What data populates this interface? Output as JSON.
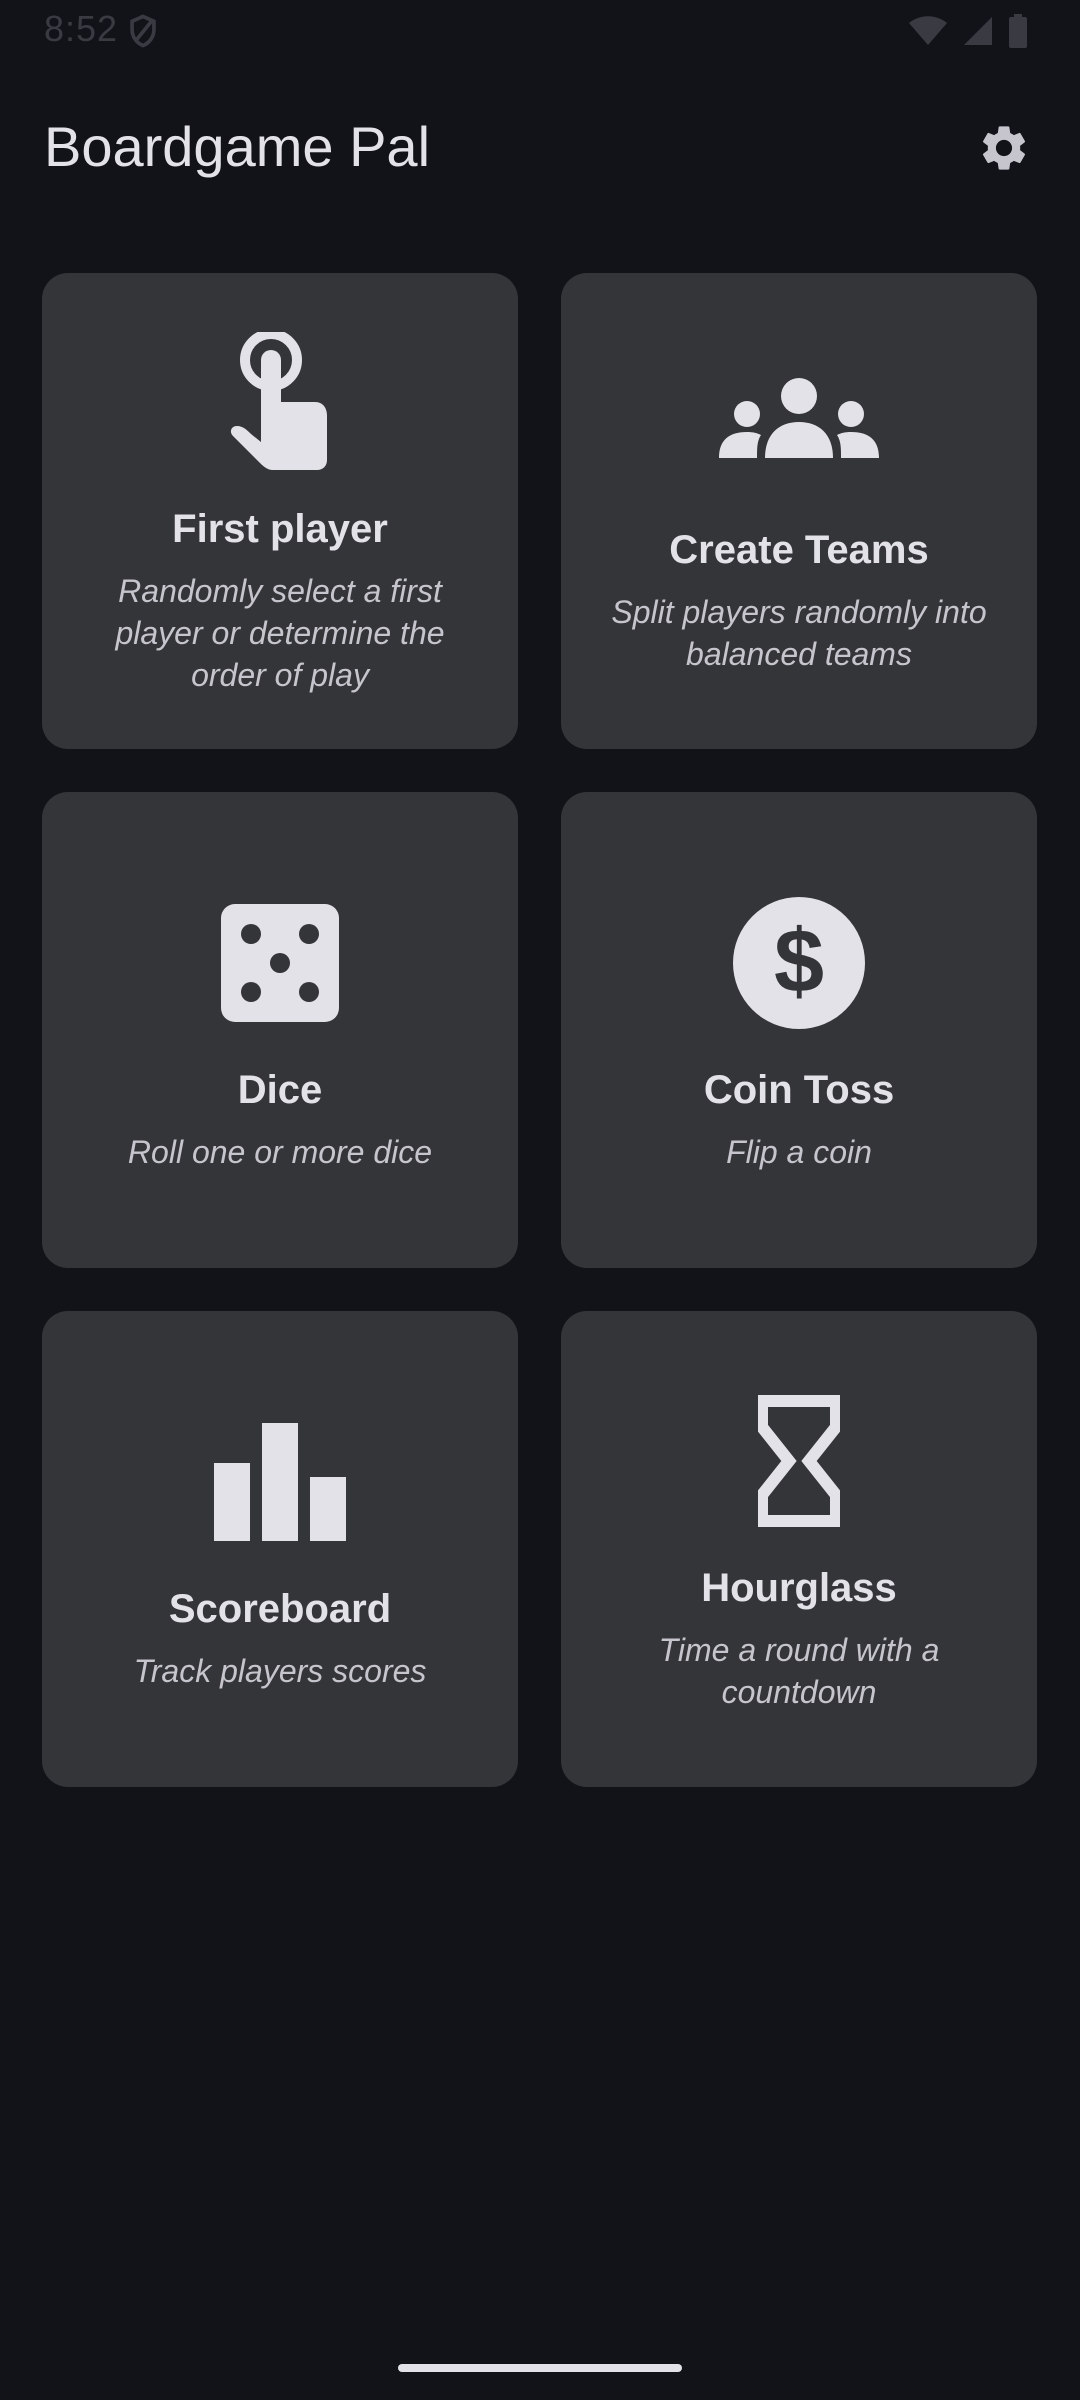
{
  "status_bar": {
    "time": "8:52"
  },
  "app_bar": {
    "title": "Boardgame Pal"
  },
  "cards": [
    {
      "title": "First player",
      "description": "Randomly select a first player or determine the order of play",
      "icon": "touch-finger-icon"
    },
    {
      "title": "Create Teams",
      "description": "Split players randomly into balanced teams",
      "icon": "groups-icon"
    },
    {
      "title": "Dice",
      "description": "Roll one or more dice",
      "icon": "dice-icon"
    },
    {
      "title": "Coin Toss",
      "description": "Flip a coin",
      "icon": "coin-dollar-icon"
    },
    {
      "title": "Scoreboard",
      "description": "Track players scores",
      "icon": "bar-chart-icon"
    },
    {
      "title": "Hourglass",
      "description": "Time a round with a countdown",
      "icon": "hourglass-icon"
    }
  ],
  "colors": {
    "background": "#121318",
    "card": "#343539",
    "text": "#E3E2E8",
    "muted_text": "#C6C5CD"
  }
}
